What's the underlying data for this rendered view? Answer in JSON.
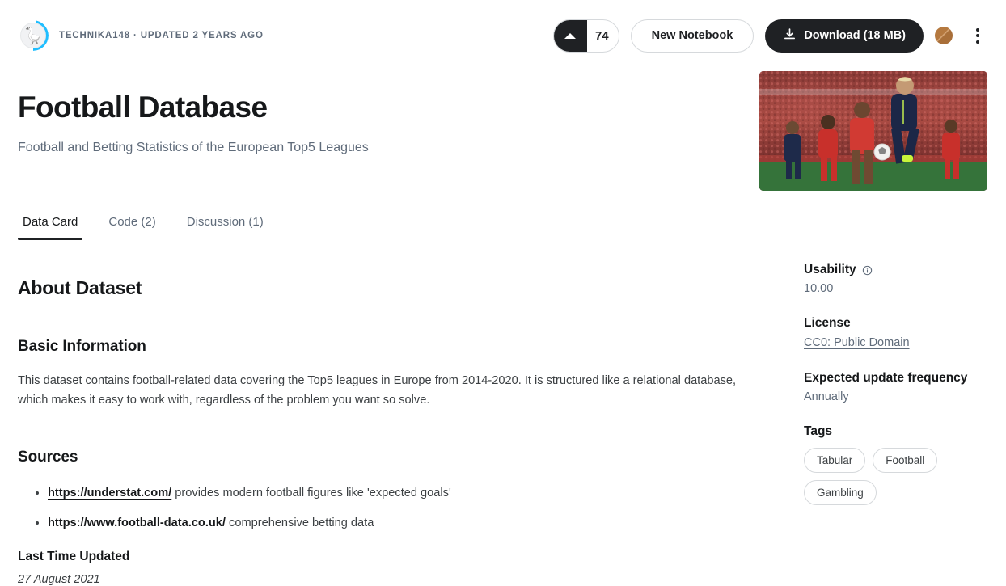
{
  "header": {
    "author": "TECHNIKA148 · UPDATED 2 YEARS AGO",
    "avatar_icon": "goose-avatar-icon",
    "upvote": {
      "count": "74",
      "arrow_icon": "caret-up-icon"
    },
    "new_notebook_label": "New Notebook",
    "download_label": "Download (18 MB)",
    "download_icon": "download-icon",
    "medal_icon": "bronze-medal-icon",
    "kebab_icon": "more-vertical-icon"
  },
  "hero": {
    "title": "Football Database",
    "subtitle": "Football and Betting Statistics of the European Top5 Leagues",
    "thumbnail_alt": "football-match-photo"
  },
  "tabs": [
    {
      "label": "Data Card",
      "active": true
    },
    {
      "label": "Code (2)",
      "active": false
    },
    {
      "label": "Discussion (1)",
      "active": false
    }
  ],
  "main": {
    "about_heading": "About Dataset",
    "basic_info_heading": "Basic Information",
    "basic_info_body": "This dataset contains football-related data covering the Top5 leagues in Europe from 2014-2020. It is structured like a relational database, which makes it easy to work with, regardless of the problem you want so solve.",
    "sources_heading": "Sources",
    "sources": [
      {
        "link": "https://understat.com/",
        "text": " provides modern football figures like 'expected goals'"
      },
      {
        "link": "https://www.football-data.co.uk/",
        "text": " comprehensive betting data"
      }
    ],
    "last_updated_heading": "Last Time Updated",
    "last_updated_value": "27 August 2021"
  },
  "sidebar": {
    "usability_label": "Usability",
    "usability_info_icon": "info-circle-icon",
    "usability_value": "10.00",
    "license_label": "License",
    "license_value": "CC0: Public Domain",
    "update_freq_label": "Expected update frequency",
    "update_freq_value": "Annually",
    "tags_label": "Tags",
    "tags": [
      "Tabular",
      "Football",
      "Gambling"
    ]
  },
  "colors": {
    "dark": "#1f2124",
    "accent": "#20beff",
    "muted": "#5f6b7a",
    "border": "#d6d9dc",
    "rule": "#e8eaed"
  }
}
